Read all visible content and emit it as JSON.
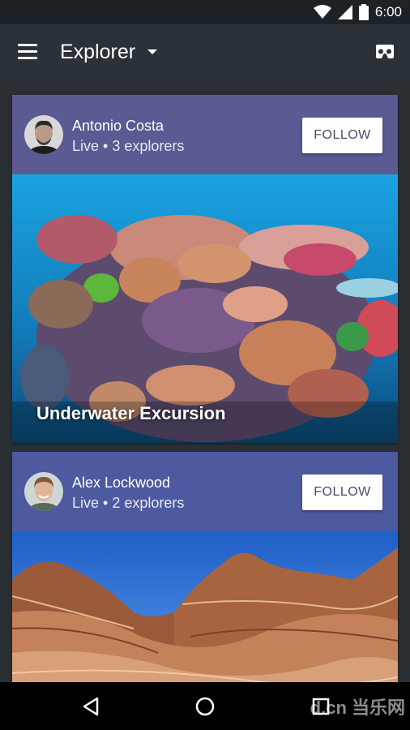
{
  "status_bar": {
    "time": "6:00",
    "icons": [
      "wifi-icon",
      "signal-icon",
      "battery-icon"
    ]
  },
  "app_bar": {
    "title": "Explorer",
    "menu_icon": "menu-icon",
    "dropdown_icon": "dropdown-arrow-icon",
    "action_icon": "vr-headset-icon"
  },
  "feed": {
    "cards": [
      {
        "user_name": "Antonio Costa",
        "status": "Live • 3 explorers",
        "follow_label": "FOLLOW",
        "image_title": "Underwater Excursion"
      },
      {
        "user_name": "Alex Lockwood",
        "status": "Live • 2 explorers",
        "follow_label": "FOLLOW",
        "image_title": ""
      }
    ]
  },
  "nav_bar": {
    "buttons": [
      "back-icon",
      "home-icon",
      "recents-icon"
    ],
    "watermark": "d.cn 当乐网"
  },
  "colors": {
    "card_bg_1": "#5b5a93",
    "card_bg_2": "#4d5aa0",
    "app_bar": "#2a3237",
    "status_bar": "#1c2226"
  }
}
